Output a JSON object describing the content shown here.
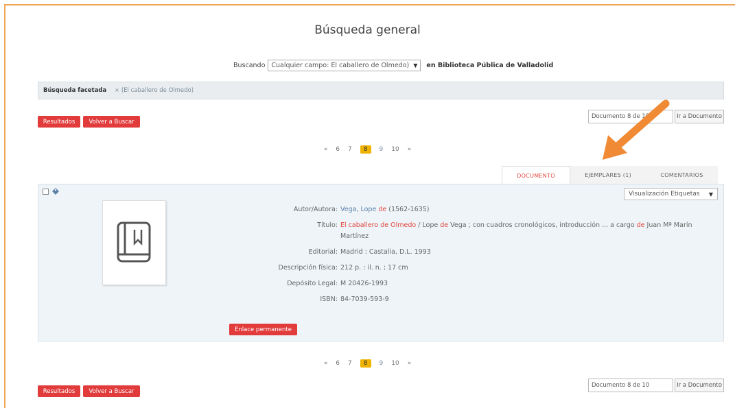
{
  "page": {
    "title": "Búsqueda general"
  },
  "search": {
    "prefix": "Buscando",
    "select_value": "Cualquier campo: El caballero de Olmedo)",
    "library": "en Biblioteca Pública de Valladolid"
  },
  "facets": {
    "label": "Búsqueda facetada",
    "item": "(El caballero de Olmedo)"
  },
  "nav": {
    "results_label": "Resultados",
    "back_label": "Volver a Buscar",
    "doc_input_top": "Documento 8 de 10",
    "doc_input_bottom": "Documento 8 de 10",
    "go_label": "Ir a Documento"
  },
  "pager": {
    "prev": "«",
    "pages": [
      "6",
      "7",
      "8",
      "9",
      "10"
    ],
    "current": "8",
    "next": "»"
  },
  "tabs": [
    {
      "label": "DOCUMENTO",
      "active": true
    },
    {
      "label": "EJEMPLARES (1)",
      "active": false
    },
    {
      "label": "COMENTARIOS",
      "active": false
    }
  ],
  "view_select": "Visualización Etiquetas",
  "record": {
    "author_label": "Autor/Autora:",
    "author_name": "Vega, Lope ",
    "author_de": "de",
    "author_dates": " (1562-1635)",
    "title_label": "Título:",
    "title_link": "El caballero de Olmedo",
    "title_sep": " / Lope ",
    "title_de": "de",
    "title_rest": " Vega ; con cuadros cronológicos, introducción ... a cargo ",
    "title_de2": "de",
    "title_rest2": " Juan Mª Marín",
    "title_line2": "Martínez",
    "publisher_label": "Editorial:",
    "publisher": "Madrid : Castalia, D.L. 1993",
    "physical_label": "Descripción física:",
    "physical": "212 p. : il. n. ; 17 cm",
    "legal_label": "Depósito Legal:",
    "legal": "M 20426-1993",
    "isbn_label": "ISBN:",
    "isbn": "84-7039-593-9",
    "permalink": "Enlace permanente"
  },
  "colors": {
    "accent": "#e23b3b",
    "highlight": "#f0b400",
    "arrow": "#f08a35"
  }
}
